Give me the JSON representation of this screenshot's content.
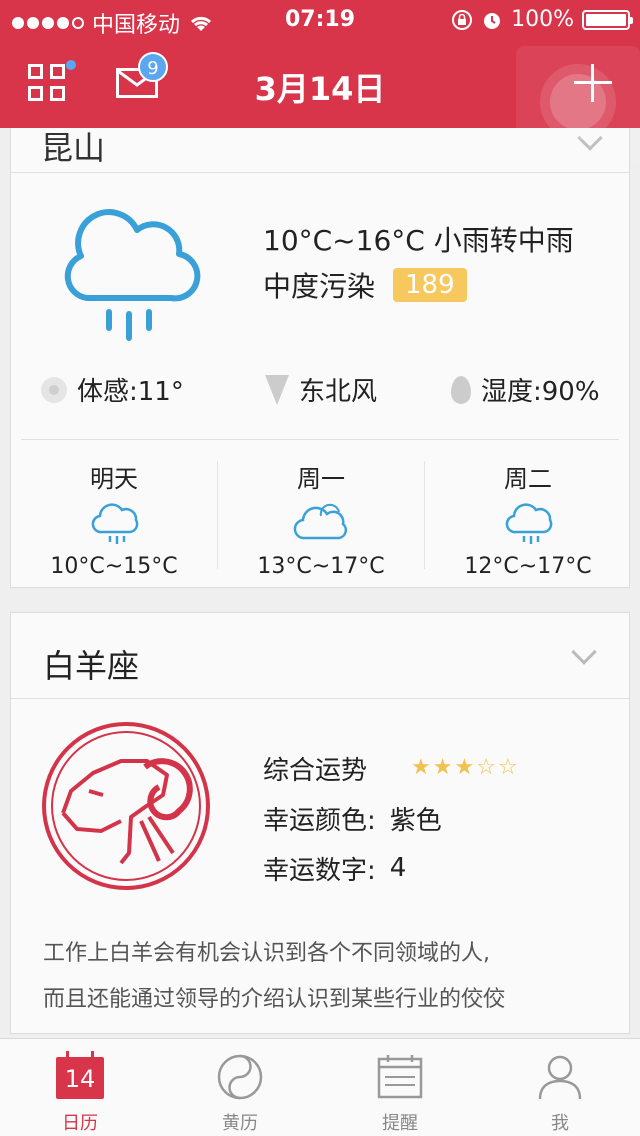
{
  "status": {
    "carrier": "中国移动",
    "time": "07:19",
    "battery": "100%",
    "battery_level": 1.0
  },
  "header": {
    "title": "3月14日",
    "mail_badge": "9"
  },
  "weather": {
    "city": "昆山",
    "temp_range": "10°C~16°C",
    "condition": "小雨转中雨",
    "pollution_label": "中度污染",
    "aqi": "189",
    "feel": "体感:11°",
    "wind": "东北风",
    "humidity": "湿度:90%",
    "forecast": [
      {
        "day": "明天",
        "range": "10°C~15°C",
        "icon": "rain-cloud-icon"
      },
      {
        "day": "周一",
        "range": "13°C~17°C",
        "icon": "cloud-icon"
      },
      {
        "day": "周二",
        "range": "12°C~17°C",
        "icon": "rain-cloud-icon"
      }
    ],
    "icon_color": "#3aa0d8"
  },
  "zodiac": {
    "name": "白羊座",
    "fortune_label": "综合运势",
    "stars_filled": 3,
    "stars_total": 5,
    "color_label": "幸运颜色:",
    "color_value": "紫色",
    "number_label": "幸运数字:",
    "number_value": "4",
    "desc_line1": "工作上白羊会有机会认识到各个不同领域的人,",
    "desc_line2": "而且还能通过领导的介绍认识到某些行业的佼佼"
  },
  "tabs": [
    {
      "label": "日历",
      "icon_text": "14",
      "active": true
    },
    {
      "label": "黄历"
    },
    {
      "label": "提醒"
    },
    {
      "label": "我"
    }
  ],
  "colors": {
    "brand": "#d8344a",
    "badge": "#5aa7f0",
    "aqi": "#f7c85e",
    "star": "#f2c14e"
  }
}
